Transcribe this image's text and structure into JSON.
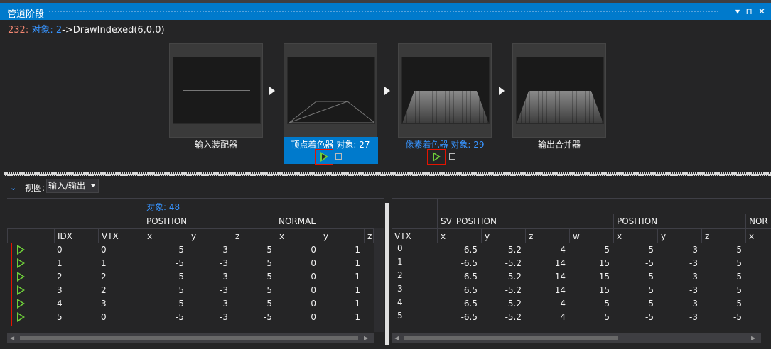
{
  "window": {
    "title": "管道阶段",
    "buttons": {
      "dropdown": "▾",
      "pin": "⊓",
      "close": "✕"
    }
  },
  "event": {
    "number": "232",
    "sep1": ":",
    "object_label": " 对象: 2",
    "call": "->DrawIndexed(6,0,0)"
  },
  "stages": [
    {
      "label": "输入装配器",
      "image": "line"
    },
    {
      "label": "顶点着色器 对象: 27",
      "image": "wireframe"
    },
    {
      "label": "像素着色器 对象: 29",
      "image": "floor"
    },
    {
      "label": "输出合并器",
      "image": "floor"
    }
  ],
  "view": {
    "label": "视图:",
    "selected": "输入/输出"
  },
  "left_table": {
    "object_label": "对象: 48",
    "group_headers": [
      "POSITION",
      "NORMAL"
    ],
    "columns": [
      "IDX",
      "VTX",
      "x",
      "y",
      "z",
      "x",
      "y",
      "z"
    ],
    "rows": [
      [
        "0",
        "0",
        "-5",
        "-3",
        "-5",
        "0",
        "1"
      ],
      [
        "1",
        "1",
        "-5",
        "-3",
        "5",
        "0",
        "1"
      ],
      [
        "2",
        "2",
        "5",
        "-3",
        "5",
        "0",
        "1"
      ],
      [
        "3",
        "2",
        "5",
        "-3",
        "5",
        "0",
        "1"
      ],
      [
        "4",
        "3",
        "5",
        "-3",
        "-5",
        "0",
        "1"
      ],
      [
        "5",
        "0",
        "-5",
        "-3",
        "-5",
        "0",
        "1"
      ]
    ]
  },
  "right_table": {
    "group_headers": [
      "SV_POSITION",
      "POSITION",
      "NOR"
    ],
    "columns": [
      "VTX",
      "x",
      "y",
      "z",
      "w",
      "x",
      "y",
      "z",
      "x"
    ],
    "rows": [
      [
        "0",
        "-6.5",
        "-5.2",
        "4",
        "5",
        "-5",
        "-3",
        "-5"
      ],
      [
        "1",
        "-6.5",
        "-5.2",
        "14",
        "15",
        "-5",
        "-3",
        "5"
      ],
      [
        "2",
        "6.5",
        "-5.2",
        "14",
        "15",
        "5",
        "-3",
        "5"
      ],
      [
        "3",
        "6.5",
        "-5.2",
        "14",
        "15",
        "5",
        "-3",
        "5"
      ],
      [
        "4",
        "6.5",
        "-5.2",
        "4",
        "5",
        "5",
        "-3",
        "-5"
      ],
      [
        "5",
        "-6.5",
        "-5.2",
        "4",
        "5",
        "-5",
        "-3",
        "-5"
      ]
    ]
  },
  "colors": {
    "accent": "#007acc",
    "highlight": "#e51400",
    "play": "#6fcf3a",
    "link": "#3794ff"
  }
}
